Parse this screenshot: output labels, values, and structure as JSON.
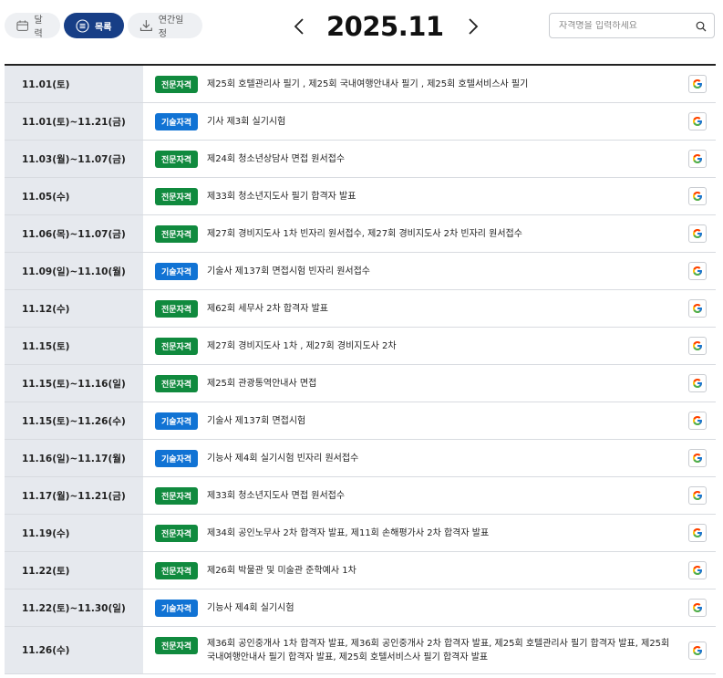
{
  "toolbar": {
    "calendar_label": "달력",
    "list_label": "목록",
    "annual_label": "연간일정"
  },
  "header": {
    "month": "2025.11",
    "prev_icon": "chevron-left-icon",
    "next_icon": "chevron-right-icon"
  },
  "search": {
    "placeholder": "자격명을 입력하세요",
    "value": ""
  },
  "colors": {
    "accent": "#173e86",
    "pro_badge": "#108a3e",
    "tech_badge": "#1173d4",
    "date_bg": "#e6e9ee"
  },
  "badges": {
    "pro": "전문자격",
    "tech": "기술자격"
  },
  "rows": [
    {
      "date": "11.01(토)",
      "type": "전문자격",
      "kind": "pro",
      "title": "제25회 호텔관리사 필기 , 제25회 국내여행안내사 필기 , 제25회 호텔서비스사 필기"
    },
    {
      "date": "11.01(토)~11.21(금)",
      "type": "기술자격",
      "kind": "tech",
      "title": "기사 제3회 실기시험"
    },
    {
      "date": "11.03(월)~11.07(금)",
      "type": "전문자격",
      "kind": "pro",
      "title": "제24회 청소년상담사 면접 원서접수"
    },
    {
      "date": "11.05(수)",
      "type": "전문자격",
      "kind": "pro",
      "title": "제33회 청소년지도사 필기 합격자 발표"
    },
    {
      "date": "11.06(목)~11.07(금)",
      "type": "전문자격",
      "kind": "pro",
      "title": "제27회 경비지도사 1차 빈자리 원서접수, 제27회 경비지도사 2차 빈자리 원서접수"
    },
    {
      "date": "11.09(일)~11.10(월)",
      "type": "기술자격",
      "kind": "tech",
      "title": "기술사 제137회 면접시험 빈자리 원서접수"
    },
    {
      "date": "11.12(수)",
      "type": "전문자격",
      "kind": "pro",
      "title": "제62회 세무사 2차 합격자 발표"
    },
    {
      "date": "11.15(토)",
      "type": "전문자격",
      "kind": "pro",
      "title": "제27회 경비지도사 1차 , 제27회 경비지도사 2차"
    },
    {
      "date": "11.15(토)~11.16(일)",
      "type": "전문자격",
      "kind": "pro",
      "title": "제25회 관광통역안내사 면접"
    },
    {
      "date": "11.15(토)~11.26(수)",
      "type": "기술자격",
      "kind": "tech",
      "title": "기술사 제137회 면접시험"
    },
    {
      "date": "11.16(일)~11.17(월)",
      "type": "기술자격",
      "kind": "tech",
      "title": "기능사 제4회 실기시험 빈자리 원서접수"
    },
    {
      "date": "11.17(월)~11.21(금)",
      "type": "전문자격",
      "kind": "pro",
      "title": "제33회 청소년지도사 면접 원서접수"
    },
    {
      "date": "11.19(수)",
      "type": "전문자격",
      "kind": "pro",
      "title": "제34회 공인노무사 2차 합격자 발표, 제11회 손해평가사 2차 합격자 발표"
    },
    {
      "date": "11.22(토)",
      "type": "전문자격",
      "kind": "pro",
      "title": "제26회 박물관 및 미술관 준학예사 1차"
    },
    {
      "date": "11.22(토)~11.30(일)",
      "type": "기술자격",
      "kind": "tech",
      "title": "기능사 제4회 실기시험"
    },
    {
      "date": "11.26(수)",
      "type": "전문자격",
      "kind": "pro",
      "title": "제36회 공인중개사 1차 합격자 발표, 제36회 공인중개사 2차 합격자 발표, 제25회 호텔관리사 필기 합격자 발표, 제25회 국내여행안내사 필기 합격자 발표, 제25회 호텔서비스사 필기 합격자 발표",
      "tall": true
    }
  ]
}
